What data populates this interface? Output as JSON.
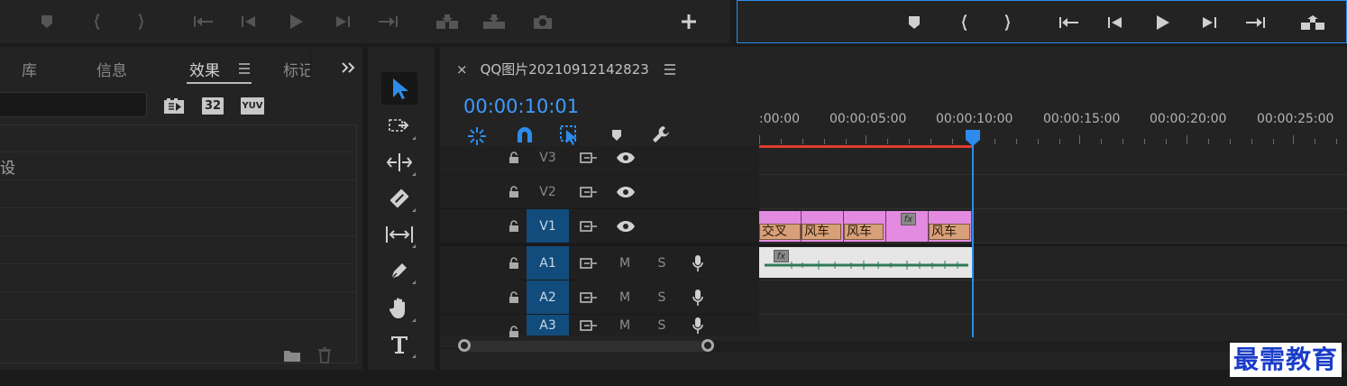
{
  "effects_panel": {
    "tabs": [
      {
        "label": "库",
        "active": false
      },
      {
        "label": "信息",
        "active": false
      },
      {
        "label": "效果",
        "active": true
      },
      {
        "label": "标记",
        "active": false
      }
    ],
    "badges": [
      "32",
      "YUV"
    ],
    "list_items": [
      "设"
    ]
  },
  "timeline": {
    "sequence_name": "QQ图片20210912142823",
    "close_glyph": "×",
    "timecode": "00:00:10:01",
    "ruler_labels": [
      ":00:00",
      "00:00:05:00",
      "00:00:10:00",
      "00:00:15:00",
      "00:00:20:00",
      "00:00:25:00"
    ],
    "video_tracks": [
      {
        "name": "V3",
        "targeted": false
      },
      {
        "name": "V2",
        "targeted": false
      },
      {
        "name": "V1",
        "targeted": true
      }
    ],
    "audio_tracks": [
      {
        "name": "A1",
        "mute": "M",
        "solo": "S"
      },
      {
        "name": "A2",
        "mute": "M",
        "solo": "S"
      },
      {
        "name": "A3",
        "mute": "M",
        "solo": "S"
      }
    ],
    "v1_clips": [
      {
        "label": "交叉"
      },
      {
        "label": "风车"
      },
      {
        "label": "风车"
      },
      {
        "label": ""
      },
      {
        "label": "风车"
      }
    ],
    "fx_label": "fx"
  },
  "colors": {
    "accent": "#2d8ceb",
    "video_clip": "#e38be0",
    "clip_label": "#d7a079",
    "audio_wave": "#2e7a55",
    "in_out_bar": "#e03c2c"
  },
  "watermark": "最需教育"
}
